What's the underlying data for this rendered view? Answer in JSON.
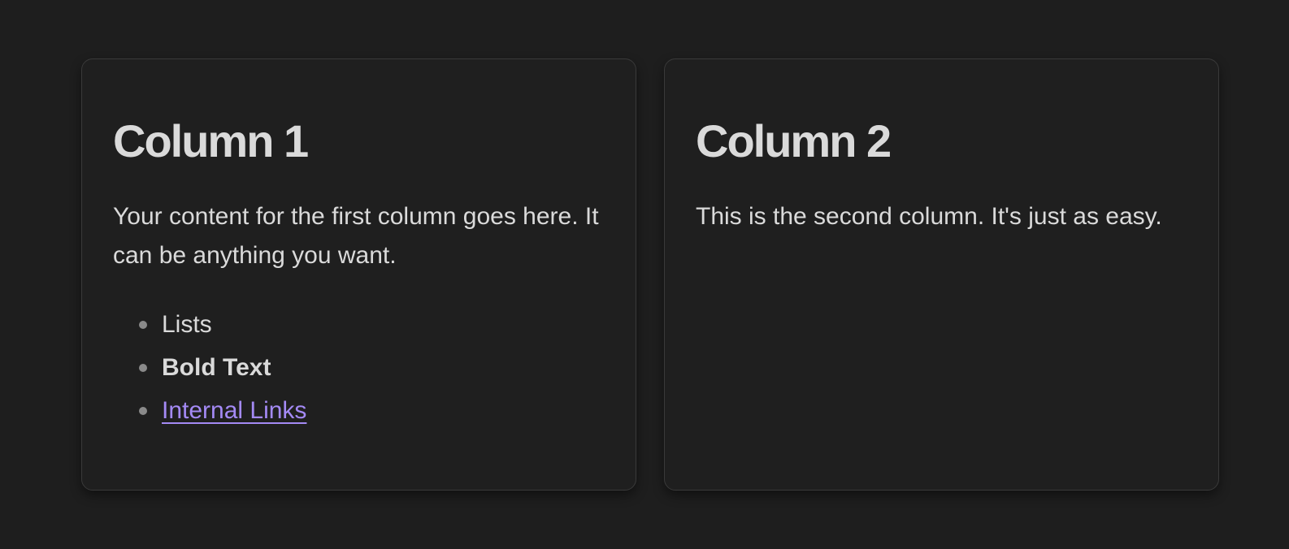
{
  "columns": [
    {
      "title": "Column 1",
      "body": "Your content for the first column goes here. It can be anything you want.",
      "list": {
        "item1": "Lists",
        "item2": "Bold Text",
        "item3": "Internal Links"
      }
    },
    {
      "title": "Column 2",
      "body": "This is the second column. It's just as easy."
    }
  ],
  "colors": {
    "background": "#1e1e1e",
    "card": "#1f1f1f",
    "text": "#dadada",
    "link": "#a48af5",
    "border": "#3a3a3a"
  }
}
